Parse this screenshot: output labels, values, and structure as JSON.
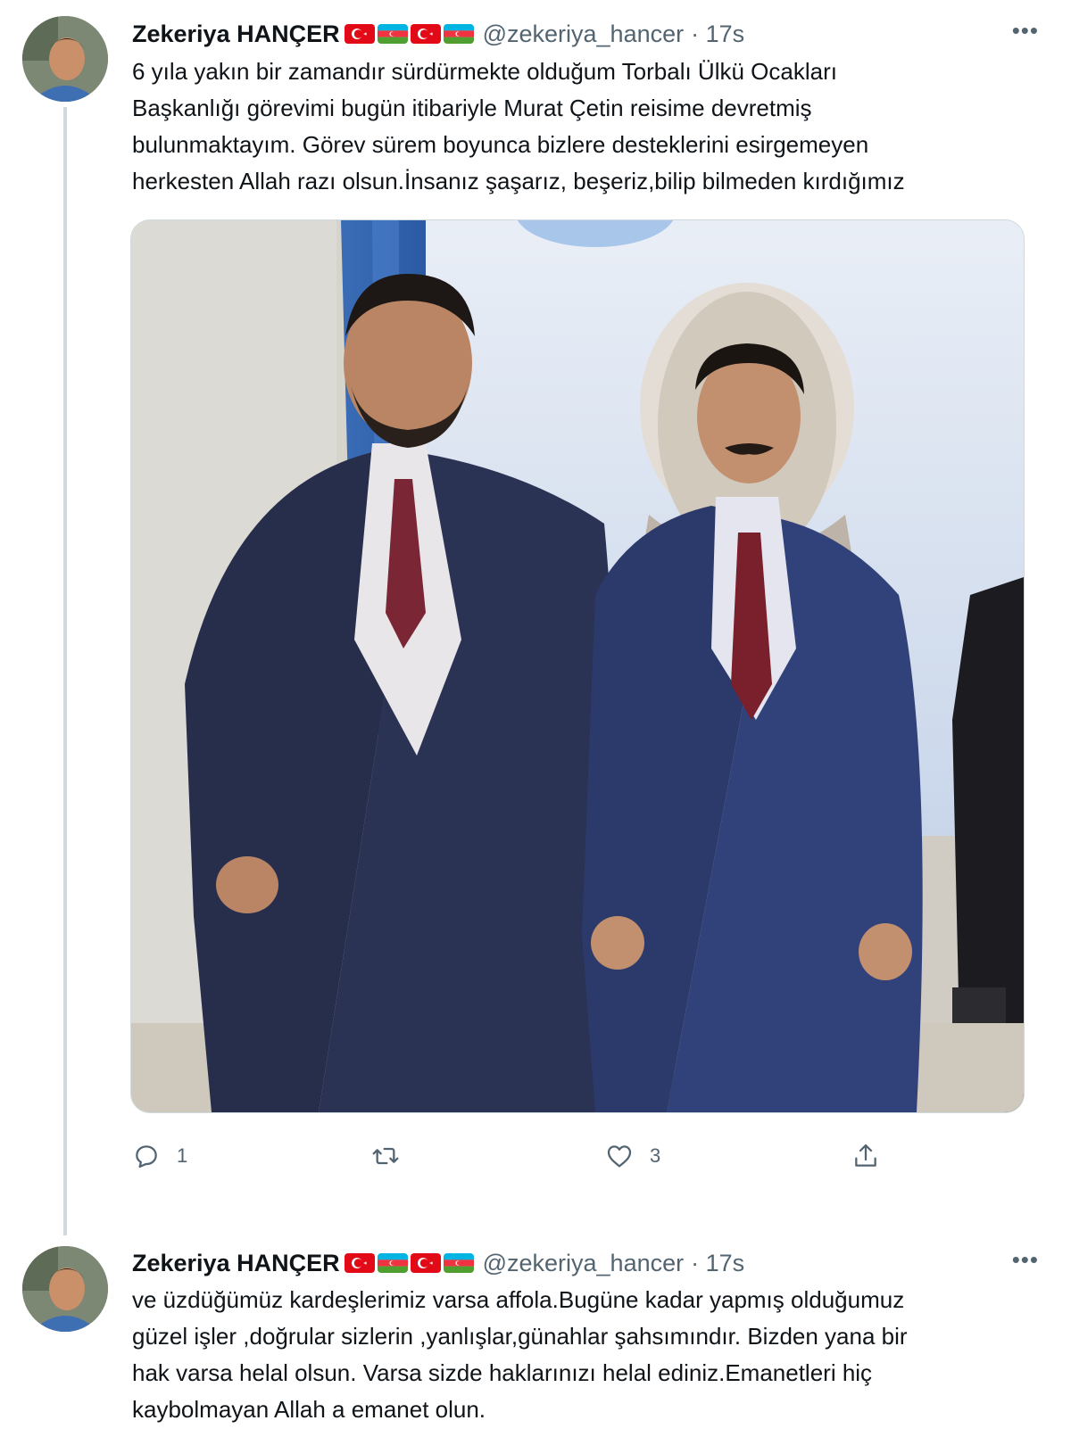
{
  "tweets": [
    {
      "author": {
        "name": "Zekeriya HANÇER",
        "handle": "@zekeriya_hancer",
        "time": "· 17s",
        "flags": [
          "turkey-flag-icon",
          "azerbaijan-flag-icon",
          "turkey-flag-icon",
          "azerbaijan-flag-icon"
        ]
      },
      "more_label": "•••",
      "text": "6 yıla yakın bir zamandır sürdürmekte olduğum Torbalı Ülkü Ocakları\nBaşkanlığı görevimi bugün itibariyle Murat Çetin reisime devretmiş\nbulunmaktayım. Görev sürem boyunca bizlere desteklerini esirgemeyen\nherkesten Allah razı olsun.İnsanız şaşarız, beşeriz,bilip bilmeden kırdığımız",
      "media": {
        "icon": "photo-two-men-in-suits"
      },
      "actions": {
        "reply_count": "1",
        "retweet_count": "",
        "like_count": "3"
      }
    },
    {
      "author": {
        "name": "Zekeriya HANÇER",
        "handle": "@zekeriya_hancer",
        "time": "· 17s",
        "flags": [
          "turkey-flag-icon",
          "azerbaijan-flag-icon",
          "turkey-flag-icon",
          "azerbaijan-flag-icon"
        ]
      },
      "more_label": "•••",
      "text": "ve üzdüğümüz kardeşlerimiz varsa affola.Bugüne kadar yapmış olduğumuz\ngüzel işler ,doğrular sizlerin ,yanlışlar,günahlar şahsımındır. Bizden yana bir\nhak varsa helal olsun. Varsa sizde haklarınızı helal ediniz.Emanetleri hiç\nkaybolmayan Allah a emanet olun."
    }
  ],
  "colors": {
    "text": "#0f1419",
    "secondary": "#536471",
    "thread_line": "#cfd9de",
    "turkey_red": "#e30a17",
    "az_blue": "#00b5e2",
    "az_red": "#ef3340",
    "az_green": "#509e2f"
  }
}
